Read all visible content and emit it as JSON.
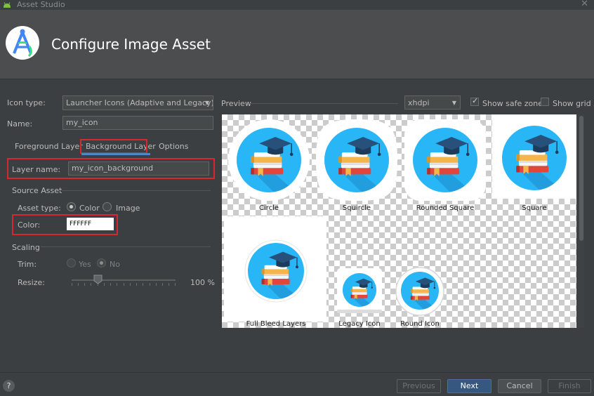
{
  "window": {
    "title": "Asset Studio",
    "close_glyph": "✕"
  },
  "header": {
    "title": "Configure Image Asset",
    "logo_icon": "android-studio-logo-icon"
  },
  "form": {
    "icon_type_label": "Icon type:",
    "icon_type_value": "Launcher Icons (Adaptive and Legacy)",
    "name_label": "Name:",
    "name_value": "my_icon"
  },
  "tabs": [
    {
      "label": "Foreground Layer",
      "selected": false
    },
    {
      "label": "Background Layer",
      "selected": true
    },
    {
      "label": "Options",
      "selected": false
    }
  ],
  "layer": {
    "label": "Layer name:",
    "value": "my_icon_background"
  },
  "source_asset": {
    "section_title": "Source Asset",
    "asset_type_label": "Asset type:",
    "options": [
      {
        "label": "Color",
        "selected": true
      },
      {
        "label": "Image",
        "selected": false
      }
    ],
    "color_label": "Color:",
    "color_value": "FFFFFF"
  },
  "scaling": {
    "section_title": "Scaling",
    "trim_label": "Trim:",
    "trim_options": [
      {
        "label": "Yes",
        "selected": false
      },
      {
        "label": "No",
        "selected": true
      }
    ],
    "resize_label": "Resize:",
    "resize_value": "100 %",
    "resize_fraction": 0.25
  },
  "preview": {
    "label": "Preview",
    "density_value": "xhdpi",
    "show_safe_zone_label": "Show safe zone",
    "show_safe_zone_checked": true,
    "show_grid_label": "Show grid",
    "show_grid_checked": false,
    "items": [
      {
        "label": "Circle"
      },
      {
        "label": "Squircle"
      },
      {
        "label": "Rounded Square"
      },
      {
        "label": "Square"
      },
      {
        "label": "Full Bleed Layers"
      },
      {
        "label": "Legacy Icon"
      },
      {
        "label": "Round Icon"
      }
    ]
  },
  "footer": {
    "help_label": "?",
    "previous_label": "Previous",
    "next_label": "Next",
    "cancel_label": "Cancel",
    "finish_label": "Finish"
  },
  "colors": {
    "icon_blue": "#29b6f6",
    "highlight_red": "#d9272f",
    "accent_blue": "#4a88c7"
  }
}
